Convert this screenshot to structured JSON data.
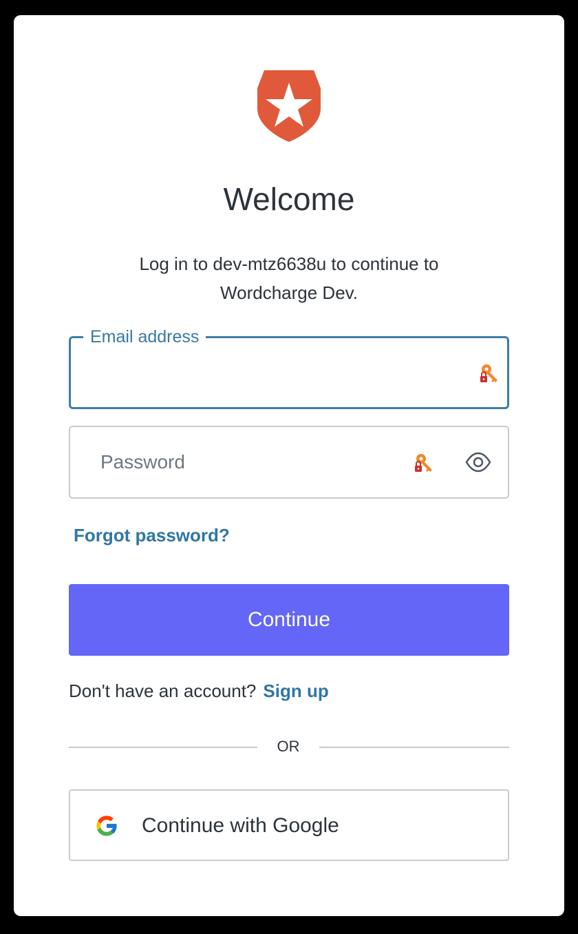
{
  "header": {
    "title": "Welcome",
    "subtitle": "Log in to dev-mtz6638u to continue to Wordcharge Dev."
  },
  "logo": {
    "icon": "auth0-shield-star-icon",
    "color": "#e0593a"
  },
  "form": {
    "email": {
      "label": "Email address",
      "value": ""
    },
    "password": {
      "placeholder": "Password",
      "value": ""
    },
    "forgot_password": "Forgot password?",
    "continue_label": "Continue"
  },
  "signup": {
    "prompt": "Don't have an account?",
    "link_label": "Sign up"
  },
  "divider": {
    "label": "OR"
  },
  "social": {
    "google_label": "Continue with Google"
  },
  "colors": {
    "accent": "#6366f6",
    "link": "#2f76a5",
    "focus_border": "#3f7ca6",
    "text": "#2d333a"
  }
}
